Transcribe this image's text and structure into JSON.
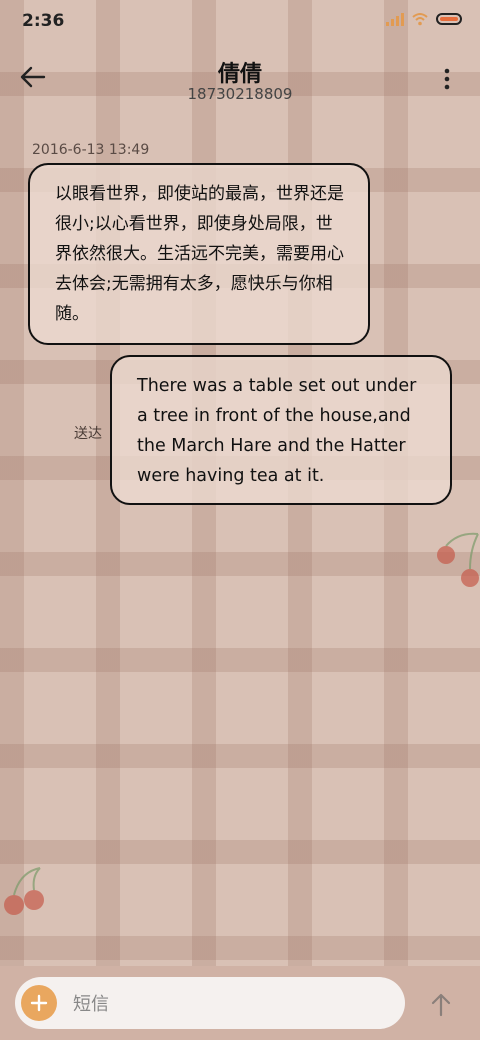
{
  "status_bar": {
    "time": "2:36",
    "icons": [
      "signal-icon",
      "wifi-icon",
      "battery-icon"
    ]
  },
  "header": {
    "contact_name": "倩倩",
    "contact_number": "18730218809",
    "back_icon": "back-arrow-icon",
    "more_icon": "more-vertical-icon"
  },
  "conversation": {
    "timestamp": "2016-6-13 13:49",
    "messages": [
      {
        "direction": "incoming",
        "text": "以眼看世界，即使站的最高，世界还是很小;以心看世界，即使身处局限，世界依然很大。生活远不完美，需要用心去体会;无需拥有太多，愿快乐与你相随。"
      },
      {
        "direction": "outgoing",
        "text": "There was a table set out under a tree in front of the house,and the March Hare and the Hatter were having tea at it.",
        "status": "送达"
      }
    ]
  },
  "composer": {
    "placeholder": "短信",
    "value": "",
    "add_icon": "plus-icon",
    "send_icon": "send-arrow-icon"
  },
  "colors": {
    "background": "#d9c1b5",
    "bubble": "#ecdad0",
    "accent": "#e9a75f",
    "battery": "#e76d3c"
  }
}
